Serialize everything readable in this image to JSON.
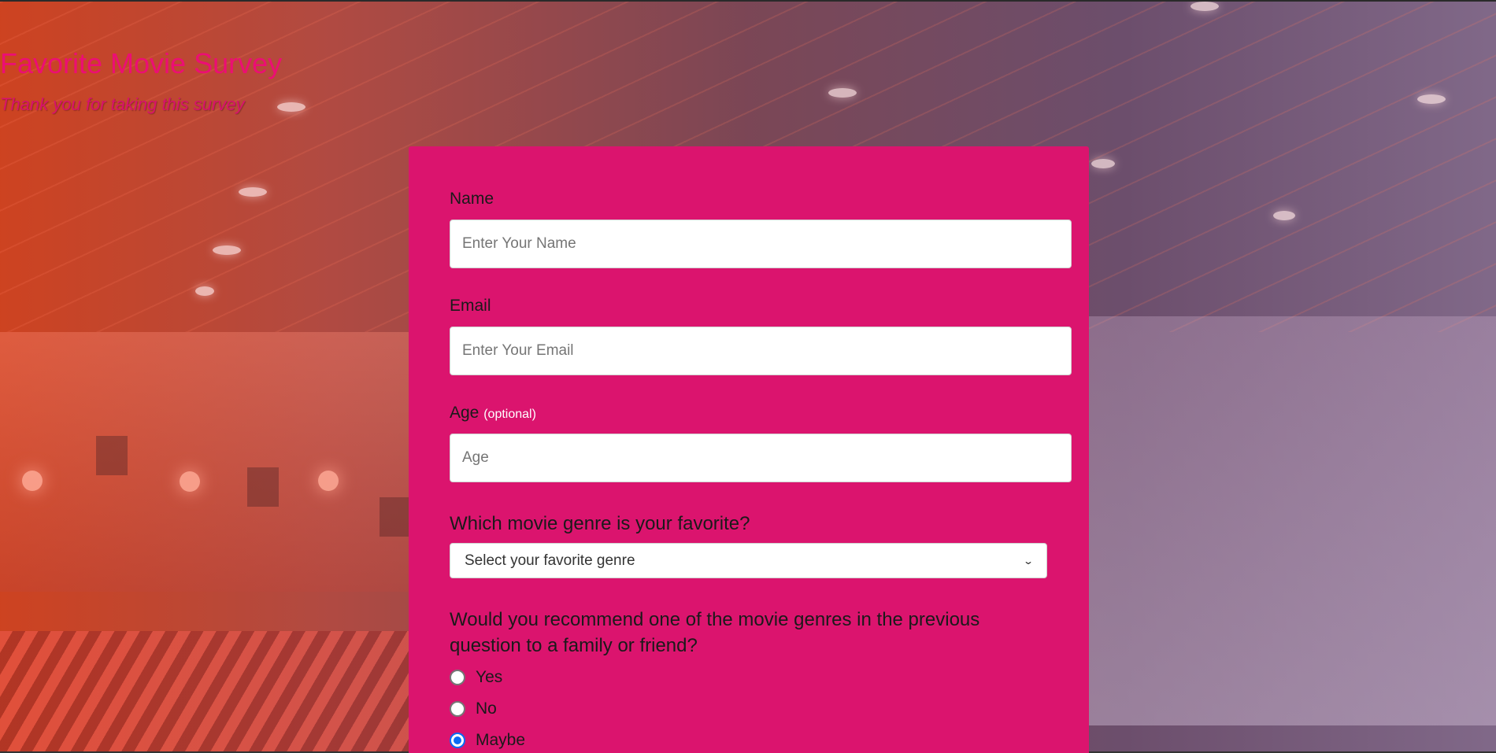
{
  "header": {
    "title": "Favorite Movie Survey",
    "subtitle": "Thank you for taking this survey"
  },
  "form": {
    "name": {
      "label": "Name",
      "placeholder": "Enter Your Name",
      "value": ""
    },
    "email": {
      "label": "Email",
      "placeholder": "Enter Your Email",
      "value": ""
    },
    "age": {
      "label": "Age",
      "optional_note": "(optional)",
      "placeholder": "Age",
      "value": ""
    },
    "genre": {
      "question": "Which movie genre is your favorite?",
      "selected": "Select your favorite genre"
    },
    "recommend": {
      "question": "Would you recommend one of the movie genres in the previous question to a family or friend?",
      "options": [
        {
          "label": "Yes",
          "checked": false
        },
        {
          "label": "No",
          "checked": false
        },
        {
          "label": "Maybe",
          "checked": true
        }
      ]
    }
  },
  "colors": {
    "card_background": "#db146e",
    "title": "#ec0e74",
    "radio_checked": "#0a6cf5"
  }
}
